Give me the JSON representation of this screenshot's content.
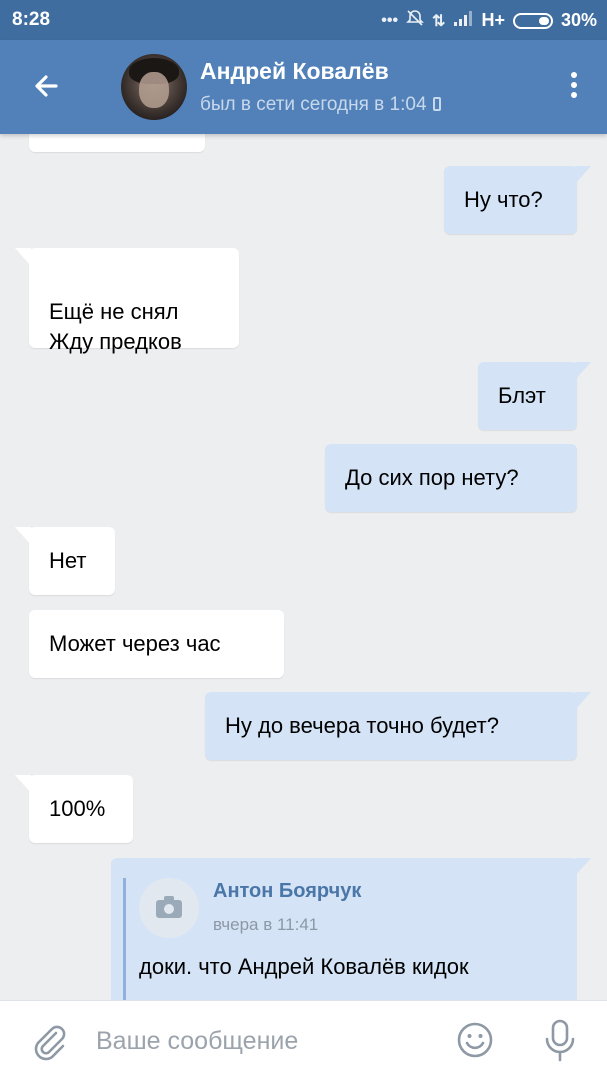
{
  "statusbar": {
    "time": "8:28",
    "network": "H+",
    "battery": "30%",
    "icons": [
      "dots-icon",
      "alarm-off-icon",
      "data-icon",
      "signal-icon",
      "battery-icon"
    ]
  },
  "header": {
    "contact_name": "Андрей Ковалёв",
    "status": "был в сети сегодня в 1:04",
    "color": "#5181b8"
  },
  "messages": [
    {
      "dir": "out",
      "text": "Ну что?"
    },
    {
      "dir": "in",
      "text": "Ещё не снял\nЖду предков"
    },
    {
      "dir": "out",
      "text": "Блэт"
    },
    {
      "dir": "out",
      "text": "До сих пор нету?"
    },
    {
      "dir": "in",
      "text": "Нет"
    },
    {
      "dir": "in",
      "text": "Может через час"
    },
    {
      "dir": "out",
      "text": "Ну до вечера точно будет?"
    },
    {
      "dir": "in",
      "text": "100%"
    }
  ],
  "forwarded": {
    "author": "Антон Боярчук",
    "time": "вчера в 11:41",
    "text": "доки. что Андрей Ковалёв кидок"
  },
  "composer": {
    "placeholder": "Ваше сообщение",
    "value": ""
  },
  "colors": {
    "background": "#edeef0",
    "incoming": "#ffffff",
    "outgoing": "#d4e3f6",
    "accent": "#4a76a8"
  }
}
